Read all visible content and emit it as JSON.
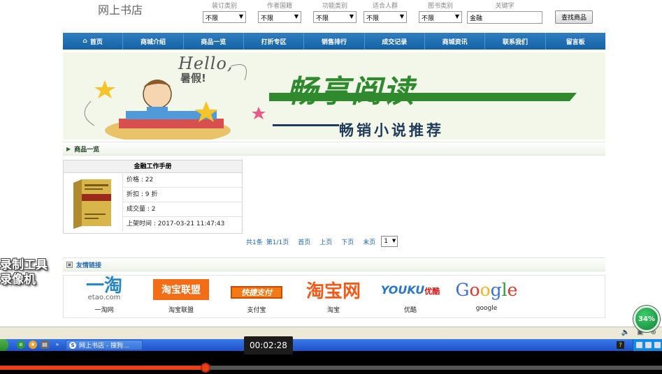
{
  "site": {
    "title": "网上书店"
  },
  "filters": [
    {
      "label": "装订类别",
      "value": "不限"
    },
    {
      "label": "作者国籍",
      "value": "不限"
    },
    {
      "label": "功能类别",
      "value": "不限"
    },
    {
      "label": "适合人群",
      "value": "不限"
    },
    {
      "label": "图书类别",
      "value": "不限"
    }
  ],
  "keyword": {
    "label": "关键字",
    "value": "金融"
  },
  "search_button": "查找商品",
  "nav": [
    "首页",
    "商城介绍",
    "商品一览",
    "打折专区",
    "销售排行",
    "成交记录",
    "商城资讯",
    "联系我们",
    "留言板"
  ],
  "banner": {
    "hello": "Hello,",
    "hello_sub": "暑假!",
    "main": "畅享阅读",
    "sub": "畅销小说推荐"
  },
  "products_section": {
    "title": "商品一览"
  },
  "product": {
    "title": "金融工作手册",
    "price": "价格 : 22",
    "discount": "折扣 : 9 折",
    "sold": "成交量 : 2",
    "listed": "上架时间 : 2017-03-21 11:47:43",
    "cover_title": "金融工作手册"
  },
  "pager": {
    "total": "共1条",
    "page_info": "第1/1页",
    "first": "首页",
    "prev": "上页",
    "next": "下页",
    "last": "末页",
    "current": "1"
  },
  "links_section": {
    "title": "友情链接"
  },
  "links": [
    {
      "logo": "一淘",
      "logo_sub": "etao.com",
      "name": "一淘网"
    },
    {
      "logo": "淘宝联盟",
      "name": "淘宝联盟"
    },
    {
      "logo": "快捷支付",
      "name": "支付宝"
    },
    {
      "logo": "淘宝网",
      "name": "淘宝"
    },
    {
      "logo": "YOUKU",
      "logo_sub": "优酷",
      "name": "优酷"
    },
    {
      "logo": "Google",
      "name": "google"
    }
  ],
  "watermark": {
    "line1": "录制工具",
    "line2": "录像机"
  },
  "taskbar": {
    "window_title": "网上书店 - 搜狗..."
  },
  "video": {
    "time": "00:02:28",
    "progress": 0.31
  },
  "badge": {
    "value": "34%"
  },
  "colors": {
    "nav": "#1e6db3",
    "progress": "#e8401c",
    "badge": "#2bb35a"
  }
}
